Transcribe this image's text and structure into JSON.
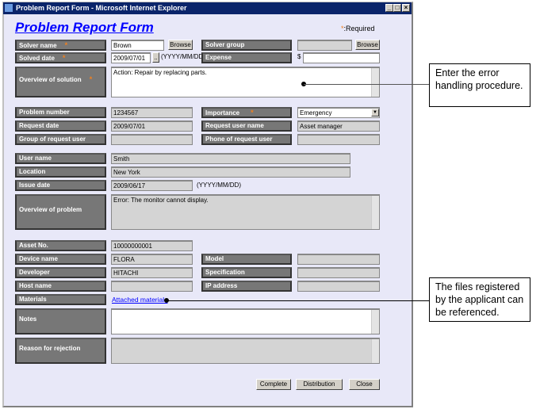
{
  "window": {
    "title": "Problem Report Form - Microsoft Internet Explorer"
  },
  "form": {
    "title": "Problem Report Form",
    "required_note": ":Required",
    "browse": "Browse",
    "date_hint": "(YYYY/MM/DD)",
    "currency": "$"
  },
  "fields": {
    "solver_name": {
      "label": "Solver name",
      "value": "Brown"
    },
    "solver_group": {
      "label": "Solver group",
      "value": ""
    },
    "solved_date": {
      "label": "Solved date",
      "value": "2009/07/01"
    },
    "expense": {
      "label": "Expense",
      "value": ""
    },
    "overview_solution": {
      "label": "Overview of solution",
      "value": "Action: Repair by replacing parts."
    },
    "problem_number": {
      "label": "Problem number",
      "value": "1234567"
    },
    "importance": {
      "label": "Importance",
      "value": "Emergency"
    },
    "request_date": {
      "label": "Request date",
      "value": "2009/07/01"
    },
    "request_user_name": {
      "label": "Request user name",
      "value": "Asset manager"
    },
    "group_request_user": {
      "label": "Group of request user",
      "value": ""
    },
    "phone_request_user": {
      "label": "Phone of request user",
      "value": ""
    },
    "user_name": {
      "label": "User name",
      "value": "Smith"
    },
    "location": {
      "label": "Location",
      "value": "New York"
    },
    "issue_date": {
      "label": "Issue date",
      "value": "2009/06/17"
    },
    "overview_problem": {
      "label": "Overview of problem",
      "value": "Error: The monitor cannot display."
    },
    "asset_no": {
      "label": "Asset No.",
      "value": "10000000001"
    },
    "device_name": {
      "label": "Device name",
      "value": "FLORA"
    },
    "model": {
      "label": "Model",
      "value": ""
    },
    "developer": {
      "label": "Developer",
      "value": "HITACHI"
    },
    "specification": {
      "label": "Specification",
      "value": ""
    },
    "host_name": {
      "label": "Host name",
      "value": ""
    },
    "ip_address": {
      "label": "IP address",
      "value": ""
    },
    "materials": {
      "label": "Materials",
      "link": "Attached materials"
    },
    "notes": {
      "label": "Notes",
      "value": ""
    },
    "reason_rejection": {
      "label": "Reason for rejection",
      "value": ""
    }
  },
  "buttons": {
    "complete": "Complete",
    "distribution": "Distribution",
    "close": "Close"
  },
  "callouts": [
    "Enter the error handling procedure.",
    "The files registered by the applicant can be referenced."
  ],
  "colors": {
    "title": "#0000ff",
    "label_bg": "#777777",
    "required": "#f08020",
    "titlebar": "#0a246a"
  }
}
